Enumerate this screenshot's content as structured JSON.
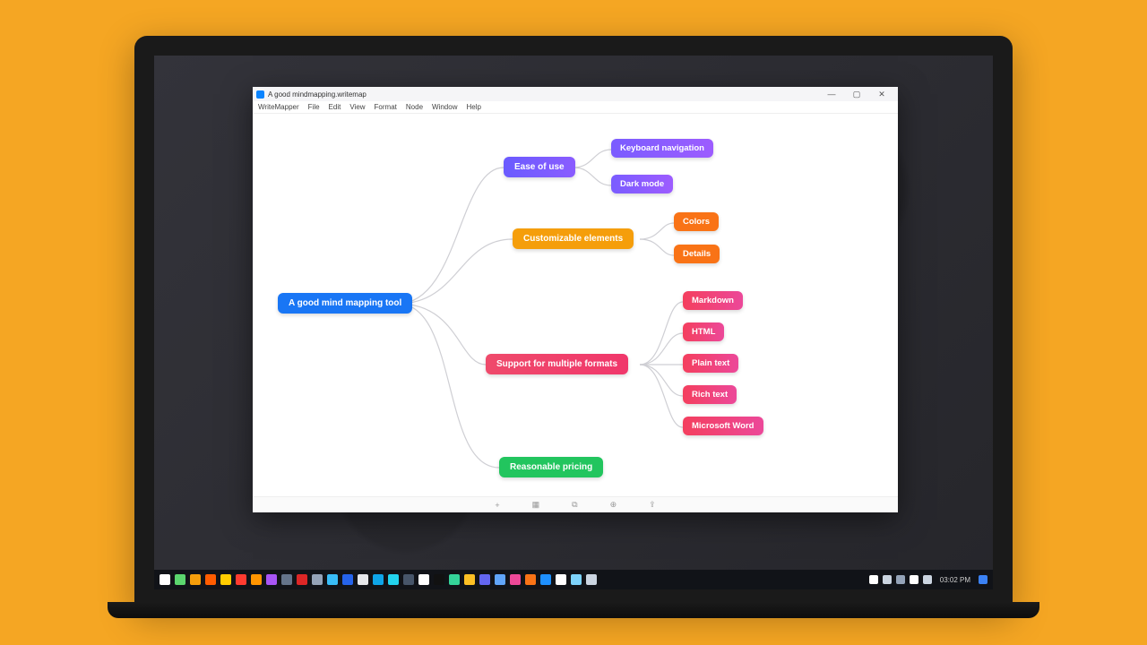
{
  "window": {
    "title": "A good mindmapping.writemap",
    "controls": {
      "min": "—",
      "max": "▢",
      "close": "✕"
    }
  },
  "menu": {
    "items": [
      "WriteMapper",
      "File",
      "Edit",
      "View",
      "Format",
      "Node",
      "Window",
      "Help"
    ]
  },
  "toolbar": {
    "add": "+",
    "grid": "▦",
    "copy": "⧉",
    "zoom": "⊕",
    "export": "⇪"
  },
  "mindmap": {
    "root": "A good mind mapping tool",
    "branches": [
      {
        "label": "Ease of use",
        "color": "purple",
        "children": [
          {
            "label": "Keyboard navigation",
            "color": "purple2"
          },
          {
            "label": "Dark mode",
            "color": "purple2"
          }
        ]
      },
      {
        "label": "Customizable elements",
        "color": "orange",
        "children": [
          {
            "label": "Colors",
            "color": "orange2"
          },
          {
            "label": "Details",
            "color": "orange2"
          }
        ]
      },
      {
        "label": "Support for multiple formats",
        "color": "pink",
        "children": [
          {
            "label": "Markdown",
            "color": "pink2"
          },
          {
            "label": "HTML",
            "color": "pink2"
          },
          {
            "label": "Plain text",
            "color": "pink2"
          },
          {
            "label": "Rich text",
            "color": "pink2"
          },
          {
            "label": "Microsoft Word",
            "color": "pink2"
          }
        ]
      },
      {
        "label": "Reasonable pricing",
        "color": "green",
        "children": []
      }
    ]
  },
  "taskbar": {
    "time": "03:02 PM",
    "icons": [
      "#ffffff",
      "#5bd66e",
      "#f59e0b",
      "#ff5c00",
      "#ffcc00",
      "#ff3b30",
      "#ff9500",
      "#a855f7",
      "#64748b",
      "#dc2626",
      "#94a3b8",
      "#38bdf8",
      "#2563eb",
      "#e5e7eb",
      "#0ea5e9",
      "#22d3ee",
      "#475569",
      "#ffffff",
      "#111",
      "#34d399",
      "#fbbf24",
      "#6366f1",
      "#60a5fa",
      "#ec4899",
      "#f97316",
      "#1e90ff",
      "#ffffff",
      "#7dd3fc",
      "#cbd5e1"
    ],
    "tray": [
      "#ffffff",
      "#cbd5e1",
      "#94a3b8",
      "#ffffff",
      "#cbd5e1"
    ]
  }
}
